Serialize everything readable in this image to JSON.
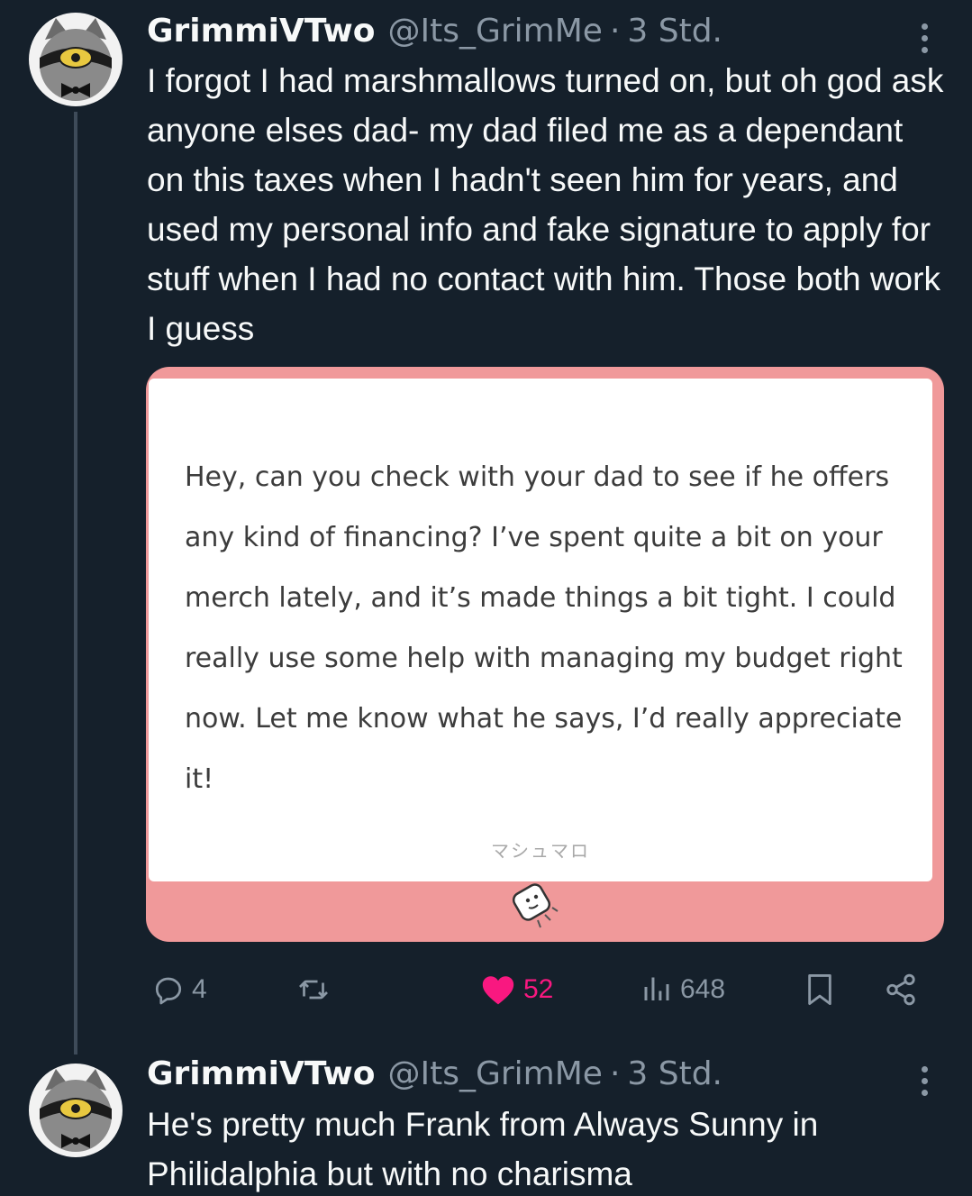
{
  "tweets": [
    {
      "display_name": "GrimmiVTwo",
      "handle": "@Its_GrimMe",
      "separator": "·",
      "time": "3 Std.",
      "text": "I forgot I had marshmallows turned on, but oh god ask anyone elses dad- my dad filed me as a dependant on this taxes when I hadn't seen him for years, and used my personal info and fake signature to apply for stuff when I had no contact with him. Those both work I guess",
      "media": {
        "question": "Hey, can you check with your dad to see if he offers any kind of financing? I’ve spent quite a bit on your merch lately, and it’s made things a bit tight. I could really use some help with managing my budget right now. Let me know what he says, I’d really appreciate it!",
        "brand": "マシュマロ"
      },
      "stats": {
        "replies": "4",
        "likes": "52",
        "views": "648"
      }
    },
    {
      "display_name": "GrimmiVTwo",
      "handle": "@Its_GrimMe",
      "separator": "·",
      "time": "3 Std.",
      "text": "He's pretty much Frank from Always Sunny in Philidalphia but with no charisma"
    }
  ],
  "colors": {
    "background": "#15202b",
    "text": "#f7f9f9",
    "secondary": "#8b98a5",
    "like": "#f91880",
    "card_border": "#f0999a"
  },
  "icons": [
    "more-options-icon",
    "reply-icon",
    "retweet-icon",
    "like-icon",
    "views-icon",
    "bookmark-icon",
    "share-icon"
  ]
}
